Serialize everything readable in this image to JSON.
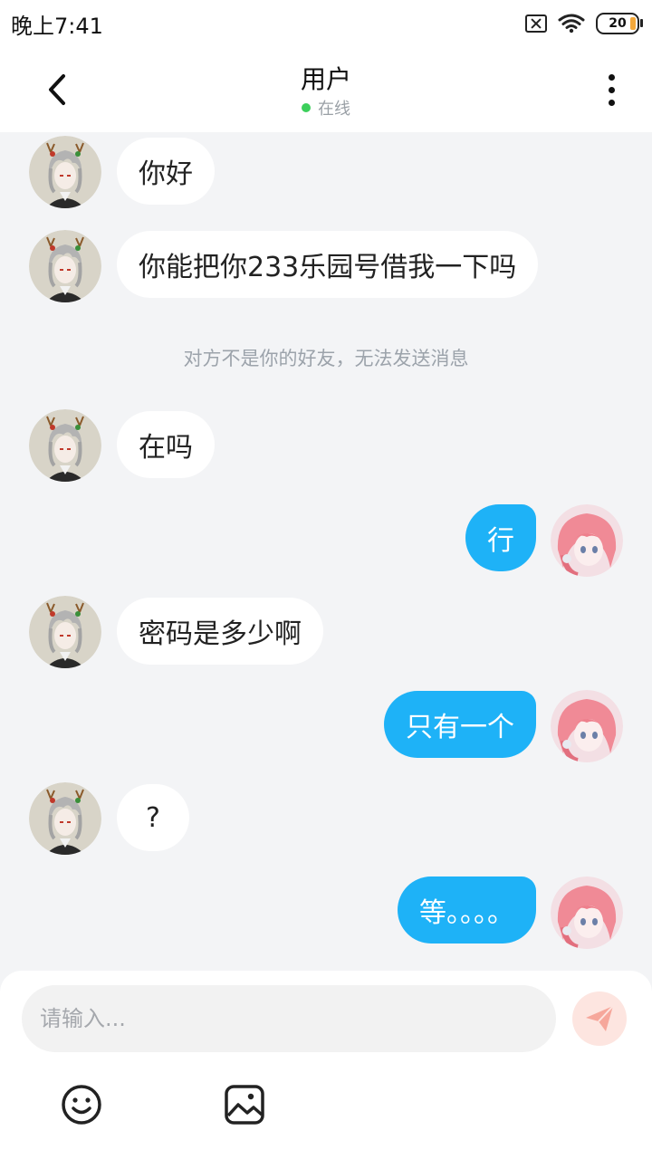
{
  "status_bar": {
    "time": "晚上7:41",
    "battery": "20"
  },
  "header": {
    "title": "用户",
    "status": "在线"
  },
  "messages": [
    {
      "side": "left",
      "text": "你好"
    },
    {
      "side": "left",
      "text": "你能把你233乐园号借我一下吗"
    },
    {
      "notice": "对方不是你的好友，无法发送消息"
    },
    {
      "side": "left",
      "text": "在吗"
    },
    {
      "side": "right",
      "text": "行"
    },
    {
      "side": "left",
      "text": "密码是多少啊"
    },
    {
      "side": "right",
      "text": "只有一个"
    },
    {
      "side": "left",
      "text": "?"
    },
    {
      "side": "right",
      "text": "等。。。。"
    }
  ],
  "composer": {
    "placeholder": "请输入...",
    "icons": {
      "send": "send-icon",
      "emoji": "emoji-icon",
      "image": "image-icon"
    }
  },
  "colors": {
    "bubble_right": "#1eb2f7",
    "bubble_left": "#ffffff",
    "background": "#f3f4f6",
    "online_dot": "#3ccf5b",
    "send_button": "#fde5e0"
  }
}
